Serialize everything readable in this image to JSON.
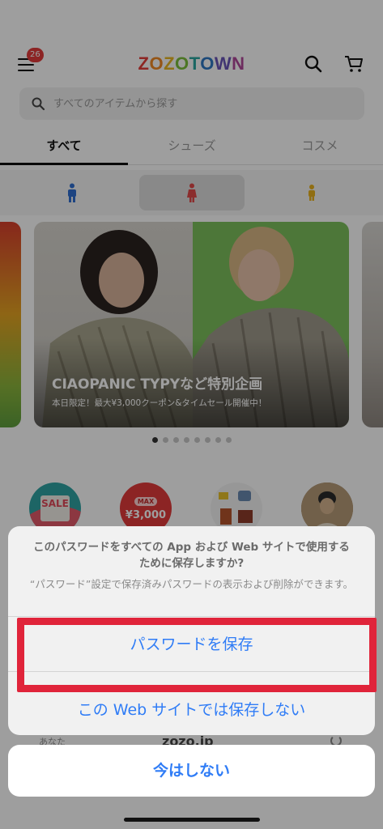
{
  "header": {
    "badge_count": "26",
    "logo": [
      "Z",
      "O",
      "Z",
      "O",
      "T",
      "O",
      "W",
      "N"
    ],
    "icons": [
      "menu-icon",
      "search-icon",
      "cart-icon"
    ]
  },
  "search": {
    "placeholder": "すべてのアイテムから探す"
  },
  "tabs": [
    {
      "label": "すべて",
      "active": true
    },
    {
      "label": "シューズ",
      "active": false
    },
    {
      "label": "コスメ",
      "active": false
    }
  ],
  "gender_filter": {
    "options": [
      {
        "icon": "man-icon",
        "color": "#2f6fd1",
        "selected": false
      },
      {
        "icon": "woman-icon",
        "color": "#e04a4a",
        "selected": true
      },
      {
        "icon": "kids-icon",
        "color": "#e8b21e",
        "selected": false
      }
    ]
  },
  "banner": {
    "title": "CIAOPANIC TYPYなど特別企画",
    "subtitle": "本日限定！最大¥3,000クーポン&タイムセール開催中！",
    "page_count": 8,
    "active_page": 1
  },
  "circles": [
    {
      "label": "SALE",
      "type": "sale"
    },
    {
      "label_top": "MAX",
      "label": "¥3,000",
      "type": "coupon"
    },
    {
      "type": "items-image"
    },
    {
      "type": "person-image"
    }
  ],
  "sheet": {
    "title": "このパスワードをすべての App および Web サイトで使用するために保存しますか?",
    "message": "“パスワード”設定で保存済みパスワードの表示および削除ができます。",
    "save_label": "パスワードを保存",
    "never_label": "この Web サイトでは保存しない",
    "cancel_label": "今はしない"
  },
  "peek": {
    "left": "あなた",
    "domain": "zozo.jp"
  },
  "colors": {
    "accent": "#2f7cf6",
    "highlight": "#e0243a"
  }
}
